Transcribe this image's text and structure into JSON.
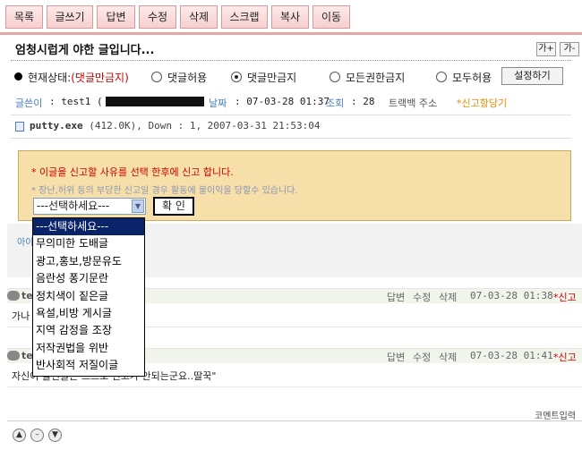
{
  "tabs": [
    {
      "label": "목록"
    },
    {
      "label": "글쓰기"
    },
    {
      "label": "답변"
    },
    {
      "label": "수정"
    },
    {
      "label": "삭제"
    },
    {
      "label": "스크랩"
    },
    {
      "label": "복사"
    },
    {
      "label": "이동"
    }
  ],
  "post": {
    "title": "엄청시럽게 야한 글입니다...",
    "font_up": "가+",
    "font_down": "가-"
  },
  "status": {
    "label": "현재상태:",
    "value": "(댓글만금지)",
    "options": [
      {
        "label": "댓글허용"
      },
      {
        "label": "댓글만금지"
      },
      {
        "label": "모든권한금지"
      },
      {
        "label": "모두허용"
      }
    ],
    "apply_label": "설정하기"
  },
  "info": {
    "author_label": "글쓴이",
    "author_value": ": test1 (",
    "date_label": "날짜",
    "date_value": ": 07-03-28 01:37",
    "views_label": "조회",
    "views_value": ": 28",
    "trackback": "트랙백 주소",
    "report": "*신고항당기"
  },
  "attachment": {
    "name": "putty.exe",
    "meta": "(412.0K), Down : 1, 2007-03-31 21:53:04"
  },
  "report_box": {
    "line1": "* 이글을 신고할 사유를 선택 한후에 신고 합니다.",
    "line2": "* 장난,허위 등의 부당한 신고일 경우 활동에 불이익을 당할수 있습니다.",
    "select_value": "---선택하세요---",
    "confirm_label": "확 인"
  },
  "dropdown": {
    "options": [
      "---선택하세요---",
      "무의미한 도배글",
      "광고,홍보,방문유도",
      "음란성 퐁기문란",
      "정치색이 짙은글",
      "욕설,비방 게시글",
      "지역 감정을 조장",
      "저작권법을 위반",
      "반사회적 저질이글"
    ]
  },
  "peek": "아이",
  "comments": [
    {
      "author": "te",
      "reply": "답변",
      "edit": "수정",
      "delete": "삭제",
      "date": "07-03-28 01:38",
      "report": "*신고",
      "text": "가나"
    },
    {
      "author": "te",
      "reply": "답변",
      "edit": "수정",
      "delete": "삭제",
      "date": "07-03-28 01:41",
      "report": "*신고",
      "text": "자신이 올린글은 스스로 신고가 안되는군요..딸꾹\""
    }
  ],
  "comment_input_label": "코멘트입력",
  "colors": {
    "accent_red": "#d40000",
    "link_blue": "#4a7fc0",
    "report_bg": "#f6dfa8",
    "tab_bg": "#f7cfcf",
    "select_highlight": "#0a246a"
  }
}
